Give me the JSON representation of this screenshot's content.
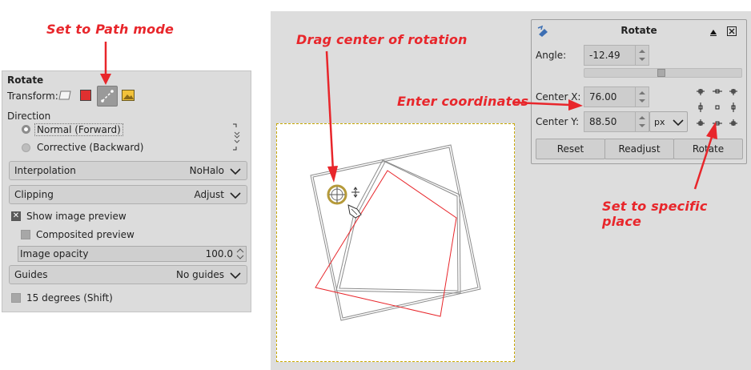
{
  "annotations": {
    "path_mode": "Set to Path mode",
    "drag_center": "Drag center of rotation",
    "enter_coords": "Enter coordinates",
    "specific_place": "Set to specific place"
  },
  "tool_options": {
    "title": "Rotate",
    "transform_label": "Transform:",
    "direction_label": "Direction",
    "direction_normal": "Normal (Forward)",
    "direction_corrective": "Corrective (Backward)",
    "interpolation_label": "Interpolation",
    "interpolation_value": "NoHalo",
    "clipping_label": "Clipping",
    "clipping_value": "Adjust",
    "show_preview_label": "Show image preview",
    "composited_label": "Composited preview",
    "opacity_label": "Image opacity",
    "opacity_value": "100.0",
    "guides_label": "Guides",
    "guides_value": "No guides",
    "degrees_label": "15 degrees (Shift)"
  },
  "dialog": {
    "title": "Rotate",
    "angle_label": "Angle:",
    "angle_value": "-12.49",
    "angle_slider_fraction": 0.49,
    "center_x_label": "Center X:",
    "center_x_value": "76.00",
    "center_y_label": "Center Y:",
    "center_y_value": "88.50",
    "unit_value": "px",
    "reset_label": "Reset",
    "readjust_label": "Readjust",
    "rotate_label": "Rotate"
  },
  "colors": {
    "annotation": "#e8262b",
    "panel_bg": "#dcdcdc",
    "canvas_border": "#c8a800",
    "pivot": "#b59a3a"
  }
}
